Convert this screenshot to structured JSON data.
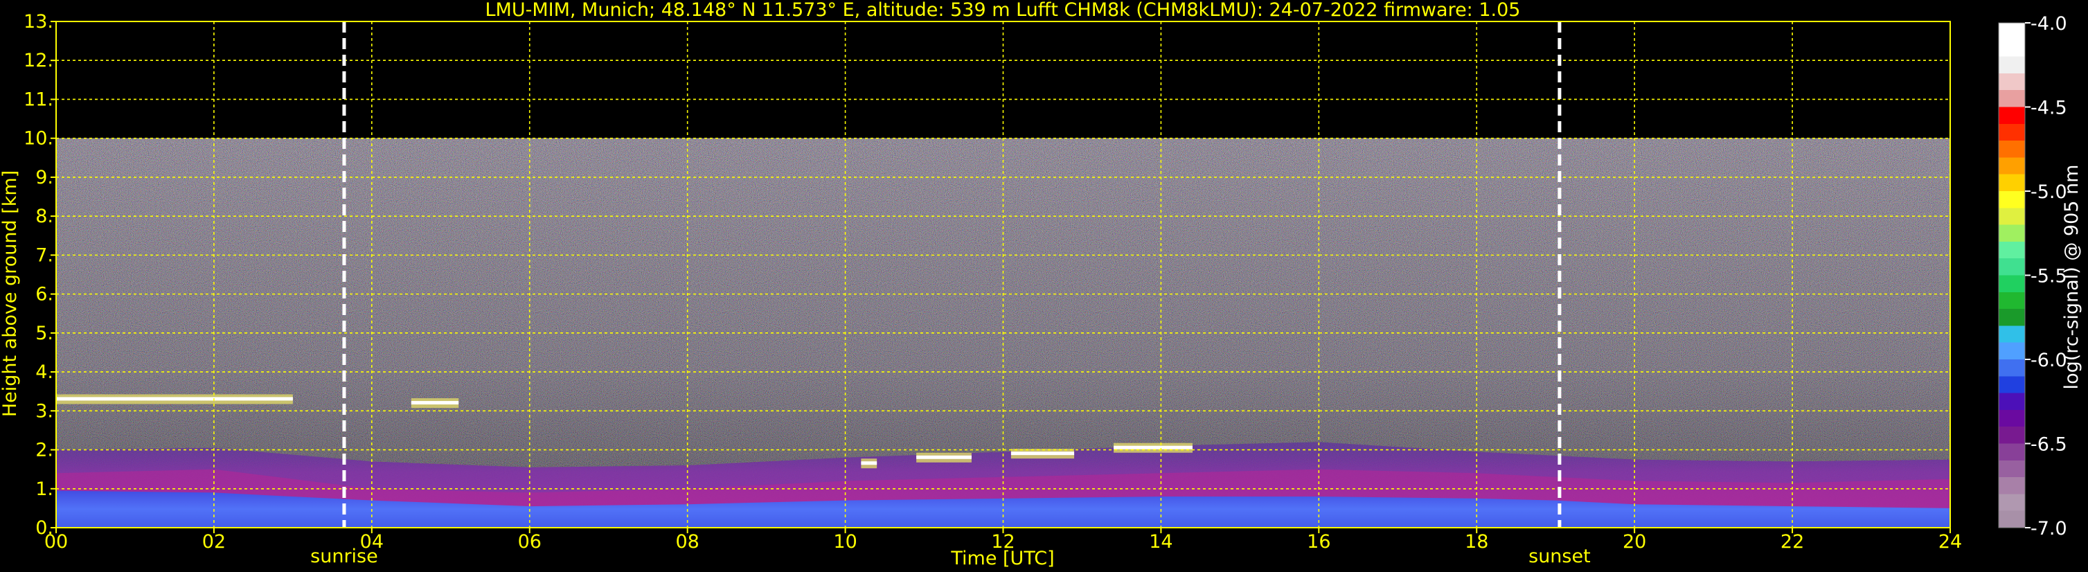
{
  "chart_data": {
    "type": "heatmap",
    "title": "LMU-MIM, Munich; 48.148° N 11.573° E, altitude: 539 m    Lufft CHM8k (CHM8kLMU): 24-07-2022    firmware: 1.05",
    "xlabel": "Time [UTC]",
    "ylabel": "Height above ground [km]",
    "xlim": [
      0,
      24
    ],
    "ylim": [
      0,
      13
    ],
    "x_ticks": [
      "00",
      "02",
      "04",
      "06",
      "08",
      "10",
      "12",
      "14",
      "16",
      "18",
      "20",
      "22",
      "24"
    ],
    "x_tick_values": [
      0,
      2,
      4,
      6,
      8,
      10,
      12,
      14,
      16,
      18,
      20,
      22,
      24
    ],
    "y_ticks": [
      "0.",
      "1.",
      "2.",
      "3.",
      "4.",
      "5.",
      "6.",
      "7.",
      "8.",
      "9.",
      "10.",
      "11.",
      "12.",
      "13."
    ],
    "y_tick_values": [
      0,
      1,
      2,
      3,
      4,
      5,
      6,
      7,
      8,
      9,
      10,
      11,
      12,
      13
    ],
    "grid": true,
    "data_top_km": 10,
    "annotations": [
      {
        "label": "sunrise",
        "x": 3.65
      },
      {
        "label": "sunset",
        "x": 19.05
      }
    ],
    "colorbar": {
      "label": "log(rc-signal) @ 905 nm",
      "ticks": [
        "-4.0",
        "-4.5",
        "-5.0",
        "-5.5",
        "-6.0",
        "-6.5",
        "-7.0"
      ],
      "tick_values": [
        -4.0,
        -4.5,
        -5.0,
        -5.5,
        -6.0,
        -6.5,
        -7.0
      ],
      "range": [
        -7.0,
        -4.0
      ],
      "colors": [
        "#a890a8",
        "#b098b0",
        "#a880a8",
        "#9860a0",
        "#884098",
        "#781a90",
        "#6a0aa0",
        "#4c10b8",
        "#2040e0",
        "#4070f0",
        "#50a0ff",
        "#30c0e8",
        "#1a9a2a",
        "#20b830",
        "#20d060",
        "#40e090",
        "#60f0a0",
        "#a0f060",
        "#e0f040",
        "#ffff20",
        "#ffd000",
        "#ffa000",
        "#ff7000",
        "#ff3000",
        "#ff0000",
        "#e8a0a0",
        "#f0c8c8",
        "#f0f0f0",
        "#ffffff",
        "#ffffff"
      ]
    },
    "cloud_layers": [
      {
        "x0": 0.0,
        "x1": 3.0,
        "y": 3.3
      },
      {
        "x0": 4.5,
        "x1": 5.1,
        "y": 3.2
      },
      {
        "x0": 10.2,
        "x1": 10.4,
        "y": 1.65
      },
      {
        "x0": 10.9,
        "x1": 11.6,
        "y": 1.8
      },
      {
        "x0": 12.1,
        "x1": 12.9,
        "y": 1.9
      },
      {
        "x0": 13.4,
        "x1": 14.4,
        "y": 2.05
      }
    ],
    "boundary_layer": [
      {
        "x": 0,
        "top": 2.0,
        "mid": 1.4,
        "aerosol": 0.95
      },
      {
        "x": 2,
        "top": 2.05,
        "mid": 1.5,
        "aerosol": 0.9
      },
      {
        "x": 4,
        "top": 1.7,
        "mid": 1.0,
        "aerosol": 0.7
      },
      {
        "x": 6,
        "top": 1.55,
        "mid": 0.9,
        "aerosol": 0.55
      },
      {
        "x": 8,
        "top": 1.6,
        "mid": 1.0,
        "aerosol": 0.6
      },
      {
        "x": 10,
        "top": 1.8,
        "mid": 1.2,
        "aerosol": 0.7
      },
      {
        "x": 12,
        "top": 1.95,
        "mid": 1.3,
        "aerosol": 0.75
      },
      {
        "x": 14,
        "top": 2.1,
        "mid": 1.4,
        "aerosol": 0.8
      },
      {
        "x": 16,
        "top": 2.2,
        "mid": 1.5,
        "aerosol": 0.8
      },
      {
        "x": 18,
        "top": 1.95,
        "mid": 1.4,
        "aerosol": 0.75
      },
      {
        "x": 19,
        "top": 1.85,
        "mid": 1.3,
        "aerosol": 0.7
      },
      {
        "x": 20,
        "top": 1.75,
        "mid": 1.2,
        "aerosol": 0.6
      },
      {
        "x": 22,
        "top": 1.7,
        "mid": 1.15,
        "aerosol": 0.55
      },
      {
        "x": 24,
        "top": 1.75,
        "mid": 1.25,
        "aerosol": 0.5
      }
    ]
  }
}
